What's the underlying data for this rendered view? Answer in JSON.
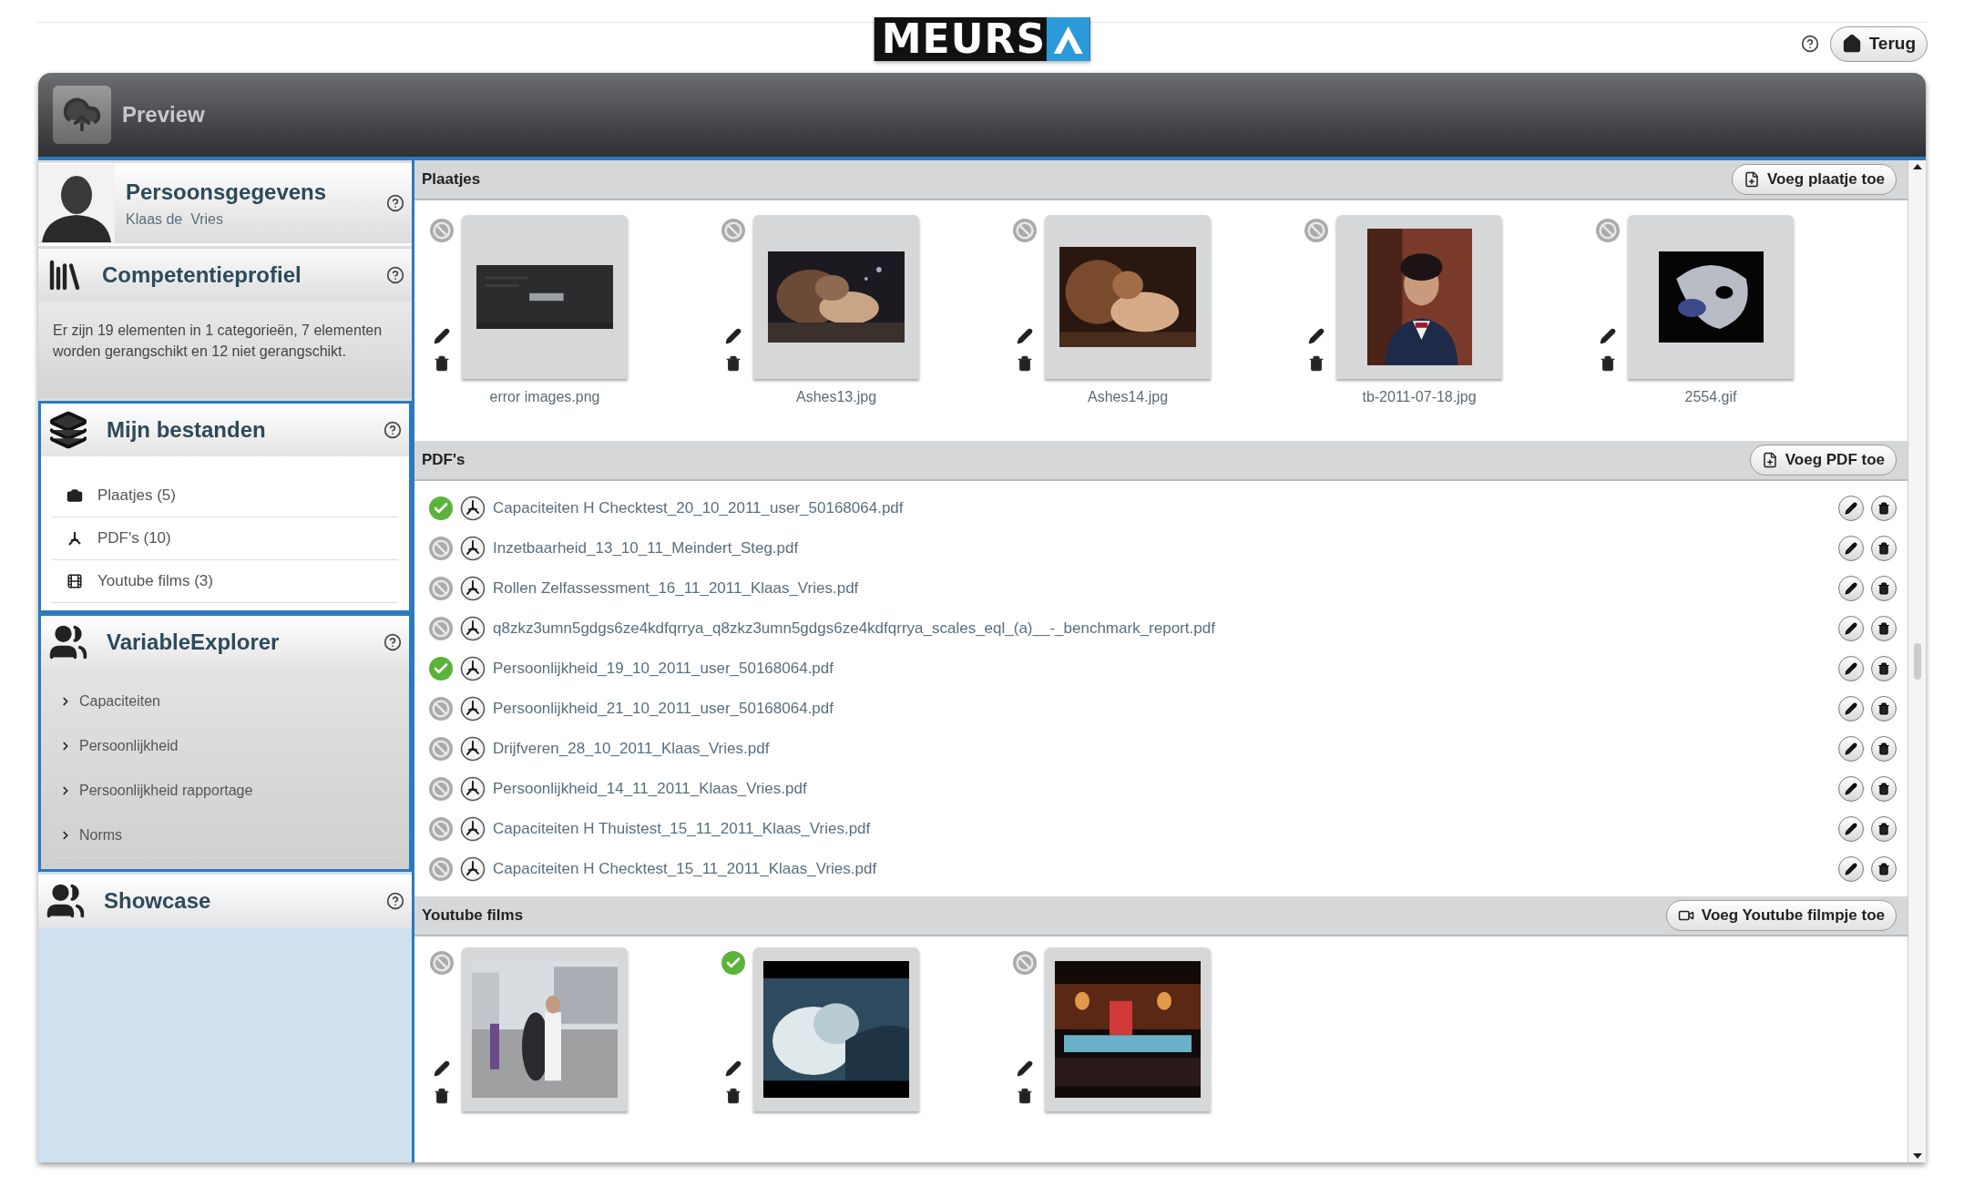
{
  "logo": {
    "text": "MEURS"
  },
  "back_button": {
    "label": "Terug"
  },
  "window": {
    "title": "Preview"
  },
  "sidebar": {
    "sections": [
      {
        "kind": "profile",
        "title": "Persoonsgegevens",
        "subtitle": "Klaas de  Vries",
        "outlined": false
      },
      {
        "kind": "text",
        "title": "Competentieprofiel",
        "description": "Er zijn 19 elementen in 1 categorieën, 7 elementen worden gerangschikt en 12 niet gerangschikt.",
        "outlined": false
      },
      {
        "kind": "files",
        "title": "Mijn bestanden",
        "outlined": true,
        "items": [
          {
            "label": "Plaatjes (5)"
          },
          {
            "label": "PDF's (10)",
            "kind": "pdf"
          },
          {
            "label": "Youtube films (3)",
            "kind": "video"
          }
        ]
      },
      {
        "kind": "tree",
        "title": "VariableExplorer",
        "outlined": true,
        "items": [
          {
            "label": "Capaciteiten"
          },
          {
            "label": "Persoonlijkheid"
          },
          {
            "label": "Persoonlijkheid rapportage"
          },
          {
            "label": "Norms"
          }
        ]
      },
      {
        "kind": "plain",
        "title": "Showcase",
        "outlined": false
      }
    ]
  },
  "sections": [
    {
      "kind": "images",
      "title": "Plaatjes",
      "add_button": "Voeg plaatje toe",
      "items": [
        {
          "caption": "error images.png",
          "approved": false
        },
        {
          "caption": "Ashes13.jpg",
          "approved": false
        },
        {
          "caption": "Ashes14.jpg",
          "approved": false
        },
        {
          "caption": "tb-2011-07-18.jpg",
          "approved": false
        },
        {
          "caption": "2554.gif",
          "approved": false
        }
      ]
    },
    {
      "kind": "pdfs",
      "title": "PDF's",
      "add_button": "Voeg PDF toe",
      "items": [
        {
          "name": "Capaciteiten H Checktest_20_10_2011_user_50168064.pdf",
          "approved": true
        },
        {
          "name": "Inzetbaarheid_13_10_11_Meindert_Steg.pdf",
          "approved": false
        },
        {
          "name": "Rollen Zelfassessment_16_11_2011_Klaas_Vries.pdf",
          "approved": false
        },
        {
          "name": "q8zkz3umn5gdgs6ze4kdfqrrya_q8zkz3umn5gdgs6ze4kdfqrrya_scales_eql_(a)__-_benchmark_report.pdf",
          "approved": false
        },
        {
          "name": "Persoonlijkheid_19_10_2011_user_50168064.pdf",
          "approved": true
        },
        {
          "name": "Persoonlijkheid_21_10_2011_user_50168064.pdf",
          "approved": false
        },
        {
          "name": "Drijfveren_28_10_2011_Klaas_Vries.pdf",
          "approved": false
        },
        {
          "name": "Persoonlijkheid_14_11_2011_Klaas_Vries.pdf",
          "approved": false
        },
        {
          "name": "Capaciteiten H Thuistest_15_11_2011_Klaas_Vries.pdf",
          "approved": false
        },
        {
          "name": "Capaciteiten H Checktest_15_11_2011_Klaas_Vries.pdf",
          "approved": false
        }
      ]
    },
    {
      "kind": "videos",
      "title": "Youtube films",
      "add_button": "Voeg Youtube filmpje toe",
      "items": [
        {
          "approved": false
        },
        {
          "approved": true
        },
        {
          "approved": false
        }
      ]
    }
  ]
}
